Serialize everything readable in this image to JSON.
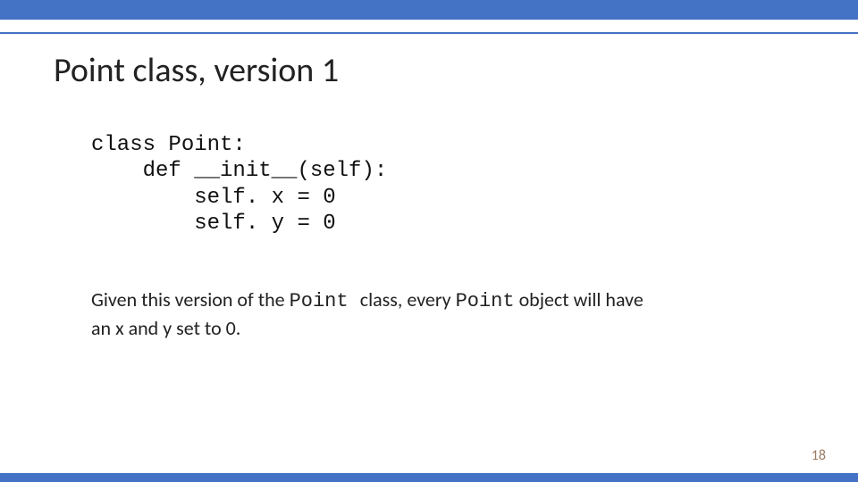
{
  "heading": "Point class, version 1",
  "code": "class Point:\n    def __init__(self):\n        self. x = 0\n        self. y = 0",
  "desc": {
    "t1": "Given this version of the ",
    "point1": "Point ",
    "t2": "class, every ",
    "point2": "Point",
    "t3": " object will have",
    "t4": " an x and y set to 0."
  },
  "page_number": "18"
}
